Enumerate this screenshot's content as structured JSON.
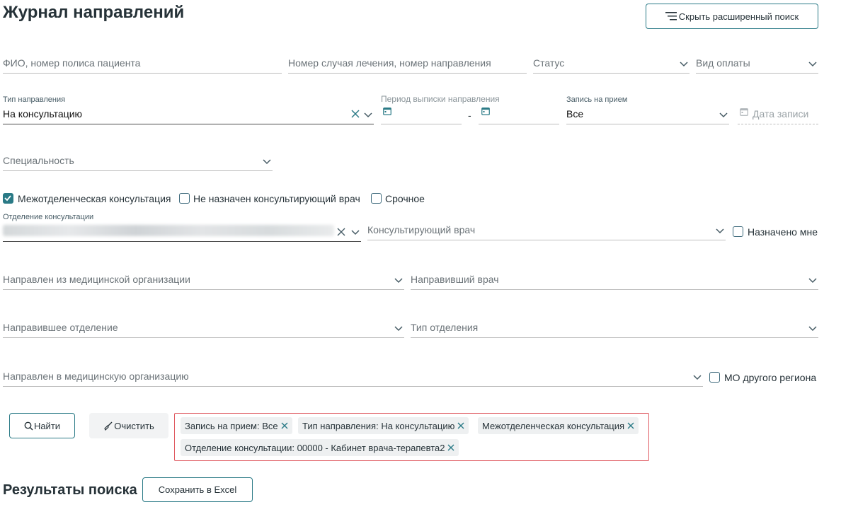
{
  "page_title": "Журнал направлений",
  "hide_search_label": "Скрыть расширенный поиск",
  "fields": {
    "patient": {
      "placeholder": "ФИО, номер полиса пациента"
    },
    "case_number": {
      "placeholder": "Номер случая лечения, номер направления"
    },
    "status": {
      "placeholder": "Статус"
    },
    "payment_type": {
      "placeholder": "Вид оплаты"
    },
    "referral_type": {
      "label": "Тип направления",
      "value": "На консультацию"
    },
    "period": {
      "label": "Период выписки направления",
      "separator": "-"
    },
    "appointment": {
      "label": "Запись на прием",
      "value": "Все"
    },
    "appointment_date": {
      "placeholder": "Дата записи"
    },
    "specialty": {
      "placeholder": "Специальность"
    },
    "consult_department": {
      "label": "Отделение консультации"
    },
    "consult_doctor": {
      "placeholder": "Консультирующий врач"
    },
    "from_org": {
      "placeholder": "Направлен из медицинской организации"
    },
    "referring_doctor": {
      "placeholder": "Направивший врач"
    },
    "referring_department": {
      "placeholder": "Направившее отделение"
    },
    "department_type": {
      "placeholder": "Тип отделения"
    },
    "to_org": {
      "placeholder": "Направлен в медицинскую организацию"
    }
  },
  "checkboxes": {
    "interdepartmental": {
      "label": "Межотделенческая консультация",
      "checked": true
    },
    "no_doctor": {
      "label": "Не назначен консультирующий врач",
      "checked": false
    },
    "urgent": {
      "label": "Срочное",
      "checked": false
    },
    "assigned_to_me": {
      "label": "Назначено мне",
      "checked": false
    },
    "other_region": {
      "label": "МО другого региона",
      "checked": false
    }
  },
  "buttons": {
    "find": "Найти",
    "clear": "Очистить",
    "save_excel": "Сохранить в Excel"
  },
  "chips": [
    "Запись на прием: Все",
    "Тип направления: На консультацию",
    "Межотделенческая консультация",
    "Отделение консультации: 00000 - Кабинет врача-терапевта2"
  ],
  "results_title": "Результаты поиска",
  "colors": {
    "accent": "#2a7a86",
    "chip_border": "#e05b62"
  }
}
